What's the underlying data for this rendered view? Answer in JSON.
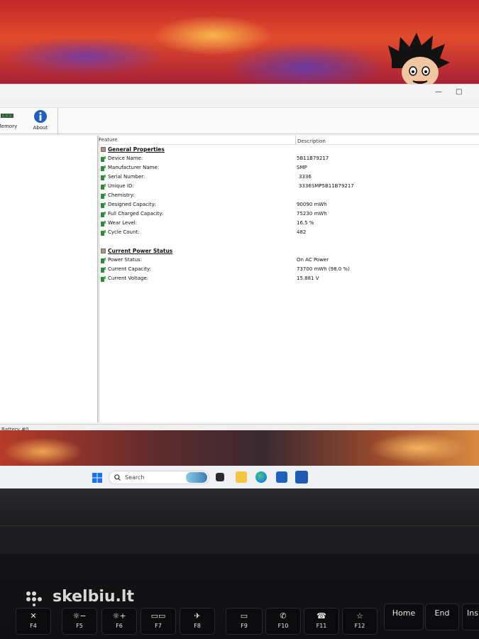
{
  "window": {
    "title_buttons": {
      "minimize": "—",
      "maximize": "□"
    }
  },
  "toolbar": {
    "items": [
      {
        "label": "Memory",
        "icon": "memory-icon"
      },
      {
        "label": "About",
        "icon": "info-icon"
      }
    ]
  },
  "table": {
    "columns": [
      "Feature",
      "Description"
    ],
    "sections": [
      {
        "title": "General Properties",
        "rows": [
          {
            "feature": "Device Name:",
            "value": "5B11B79217"
          },
          {
            "feature": "Manufacturer Name:",
            "value": "SMP"
          },
          {
            "feature": "Serial Number:",
            "value": "3336"
          },
          {
            "feature": "Unique ID:",
            "value": "3336SMP5B11B79217"
          },
          {
            "feature": "Chemistry:",
            "value": ""
          },
          {
            "feature": "Designed Capacity:",
            "value": "90090 mWh"
          },
          {
            "feature": "Full Charged Capacity:",
            "value": "75230 mWh"
          },
          {
            "feature": "Wear Level:",
            "value": "16.5 %"
          },
          {
            "feature": "Cycle Count:",
            "value": "482"
          }
        ]
      },
      {
        "title": "Current Power Status",
        "rows": [
          {
            "feature": "Power Status:",
            "value": "On AC Power"
          },
          {
            "feature": "Current Capacity:",
            "value": "73700 mWh (98.0 %)"
          },
          {
            "feature": "Current Voltage:",
            "value": "15.881 V"
          }
        ]
      }
    ]
  },
  "statusbar": {
    "text": "Battery #0"
  },
  "taskbar": {
    "search_placeholder": "Search",
    "apps": [
      "start-icon",
      "widgets-icon",
      "task-view-icon",
      "file-explorer-icon",
      "edge-icon",
      "store-icon",
      "batteryinfoview-icon"
    ]
  },
  "keyboard": {
    "keys": [
      {
        "label": "F4",
        "symbol": "✕"
      },
      {
        "label": "F5",
        "symbol": "☼−"
      },
      {
        "label": "F6",
        "symbol": "☼+"
      },
      {
        "label": "F7",
        "symbol": "▭▭"
      },
      {
        "label": "F8",
        "symbol": "✈"
      },
      {
        "label": "F9",
        "symbol": "▭"
      },
      {
        "label": "F10",
        "symbol": "✆"
      },
      {
        "label": "F11",
        "symbol": "☎"
      },
      {
        "label": "F12",
        "symbol": "☆"
      },
      {
        "label": "Home",
        "symbol": ""
      },
      {
        "label": "End",
        "symbol": ""
      },
      {
        "label": "Ins",
        "symbol": ""
      }
    ]
  },
  "watermark": {
    "text": "skelbiu.lt"
  },
  "colors": {
    "leaf_green": "#2e8b3a",
    "section_square": "#a89684",
    "info_blue": "#1f5fbf"
  }
}
